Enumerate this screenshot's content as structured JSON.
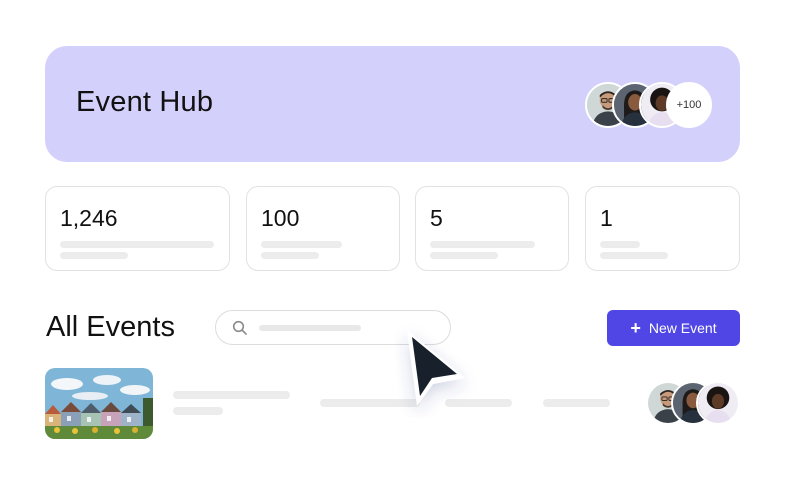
{
  "hub": {
    "title": "Event Hub",
    "attendees": [
      {
        "icon": "avatar-man-glasses"
      },
      {
        "icon": "avatar-woman-dark-hair"
      },
      {
        "icon": "avatar-woman-curly-hair"
      }
    ],
    "more_label": "+100"
  },
  "stats": [
    {
      "value": "1,246"
    },
    {
      "value": "100"
    },
    {
      "value": "5"
    },
    {
      "value": "1"
    }
  ],
  "events": {
    "title": "All Events",
    "search_icon": "search-icon",
    "new_event_label": "New Event",
    "new_event_icon": "plus-icon",
    "rows": [
      {
        "thumbnail": "painted-ladies-houses-photo",
        "attendees": [
          "avatar-man-glasses",
          "avatar-woman-dark-hair",
          "avatar-woman-curly-hair"
        ]
      }
    ]
  },
  "colors": {
    "hub_background": "#d3d0fb",
    "accent": "#5046e5",
    "placeholder_bar": "#ececec",
    "card_border": "#e2e2e2"
  }
}
